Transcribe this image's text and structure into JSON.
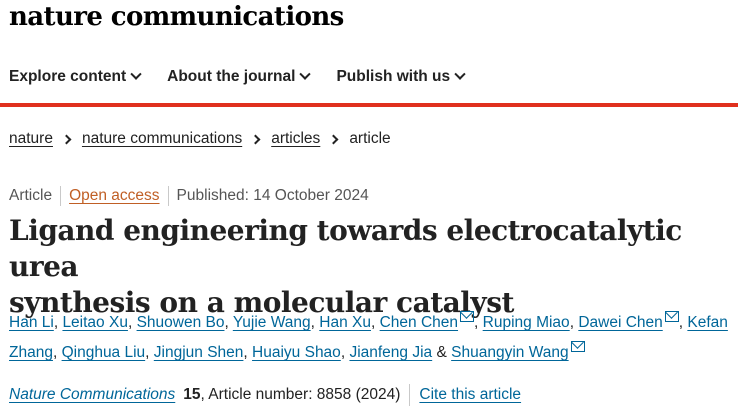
{
  "header": {
    "brand": "nature communications"
  },
  "nav": {
    "items": [
      {
        "label": "Explore content"
      },
      {
        "label": "About the journal"
      },
      {
        "label": "Publish with us"
      }
    ]
  },
  "breadcrumb": {
    "items": [
      "nature",
      "nature communications",
      "articles"
    ],
    "current": "article"
  },
  "meta": {
    "type": "Article",
    "access": "Open access",
    "published": "Published: 14 October 2024"
  },
  "title": {
    "line1": "Ligand engineering towards electrocatalytic urea",
    "line2": "synthesis on a molecular catalyst"
  },
  "authors": [
    "Han Li",
    "Leitao Xu",
    "Shuowen Bo",
    "Yujie Wang",
    "Han Xu",
    "Chen Chen",
    "Ruping Miao",
    "Dawei Chen",
    "Kefan",
    "Zhang",
    "Qinghua Liu",
    "Jingjun Shen",
    "Huaiyu Shao",
    "Jianfeng Jia",
    "Shuangyin Wang"
  ],
  "authors_sep": {
    "comma": ",",
    "amp": "&"
  },
  "citation": {
    "journal": "Nature Communications",
    "volume": "15",
    "details": ", Article number: 8858 (2024)",
    "cite_link": "Cite this article"
  },
  "colors": {
    "accent_red": "#e0301e",
    "link_blue": "#006699",
    "open_access_orange": "#c05f25"
  }
}
